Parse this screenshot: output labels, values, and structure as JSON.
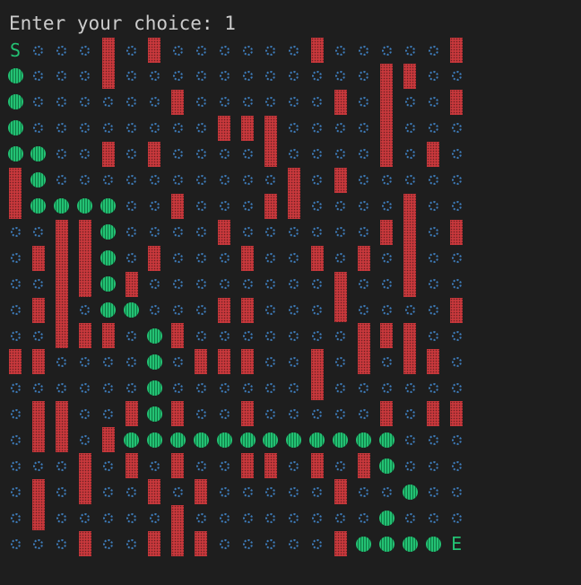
{
  "terminal": {
    "prompt": "Enter your choice: 1"
  },
  "maze": {
    "start_label": "S",
    "end_label": "E",
    "legend_chars": {
      "S": "start",
      "E": "end",
      "#": "wall",
      "o": "open",
      "*": "path"
    },
    "colors": {
      "wall": "#c8383c",
      "open": "#3f7fbf",
      "path": "#23c173",
      "background": "#1e1e1e"
    },
    "rows": [
      "Sooo#o#oooooo#ooooo#",
      "*ooo#ooooooooooo##oo",
      "*oooooo#oooooo#o#oo#",
      "*oooooooo###oooo#ooo",
      "**oo#o#oooo#oooo#o#o",
      "#*oooooooooo#o#ooooo",
      "#****oo#ooo##oooo#oo",
      "oo##*oooo#oooooo##o#",
      "o###*o#ooo#oo#o#o#oo",
      "oo##*#oooooooo#oo#oo",
      "o##o**ooo##ooo#oooo#",
      "oo###o*#ooooooo###oo",
      "##oooo*o###oo#o#o##o",
      "oooooo*oooooo#oooooo",
      "o##oo#*#oo#ooooo#o##",
      "o##o#************ooo",
      "ooo#o#o#oo##o#o#*ooo",
      "o#o#oo#o#ooooo#oo*oo",
      "o#ooooo#oooooooo*ooo",
      "ooo#oo###ooooo#****E"
    ]
  }
}
